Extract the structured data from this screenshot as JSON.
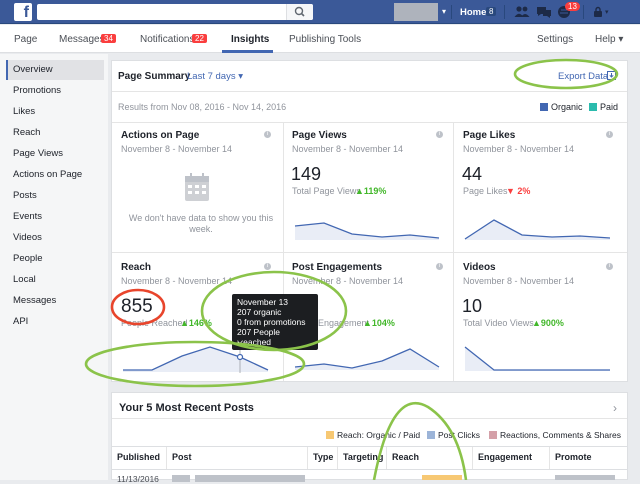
{
  "topbar": {
    "logo": "f",
    "home": "Home",
    "home_count": "8",
    "notif_count": "13"
  },
  "nav": {
    "page": "Page",
    "messages": "Messages",
    "messages_count": "34",
    "notifications": "Notifications",
    "notifications_count": "22",
    "insights": "Insights",
    "publishing_tools": "Publishing Tools",
    "settings": "Settings",
    "help": "Help ▾"
  },
  "sidebar": {
    "items": [
      "Overview",
      "Promotions",
      "Likes",
      "Reach",
      "Page Views",
      "Actions on Page",
      "Posts",
      "Events",
      "Videos",
      "People",
      "Local",
      "Messages",
      "API"
    ]
  },
  "summary": {
    "title": "Page Summary",
    "range": "Last 7 days ▾",
    "export": "Export Data",
    "results": "Results from Nov 08, 2016 - Nov 14, 2016",
    "legend_organic": "Organic",
    "legend_paid": "Paid"
  },
  "cards": {
    "actions": {
      "title": "Actions on Page",
      "date": "November 8 - November 14",
      "empty": "We don't have data to show you this week."
    },
    "views": {
      "title": "Page Views",
      "date": "November 8 - November 14",
      "value": "149",
      "label": "Total Page Views",
      "change": "▲119%"
    },
    "likes": {
      "title": "Page Likes",
      "date": "November 8 - November 14",
      "value": "44",
      "label": "Page Likes",
      "change": "▼ 2%"
    },
    "reach": {
      "title": "Reach",
      "date": "November 8 - November 14",
      "value": "855",
      "label": "People Reached",
      "change": "▲146%"
    },
    "engage": {
      "title": "Post Engagements",
      "date": "November 8 - November 14",
      "value": "6",
      "label": "Engagement",
      "change": "▲104%"
    },
    "videos": {
      "title": "Videos",
      "date": "November 8 - November 14",
      "value": "10",
      "label": "Total Video Views",
      "change": "▲900%"
    }
  },
  "tooltip": {
    "l1": "November 13",
    "l2": "207 organic",
    "l3": "0 from promotions",
    "l4": "207 People Reached"
  },
  "posts": {
    "title": "Your 5 Most Recent Posts",
    "legend": [
      "Reach: Organic / Paid",
      "Post Clicks",
      "Reactions, Comments & Shares"
    ],
    "headers": [
      "Published",
      "Post",
      "Type",
      "Targeting",
      "Reach",
      "Engagement",
      "Promote"
    ],
    "row_date": "11/13/2016"
  },
  "colors": {
    "organic": "#4267b2",
    "paid": "#2bbbad",
    "reach_legend": "#f7c873",
    "clicks_legend": "#9cb4d8",
    "reactions_legend": "#d4a0a8",
    "annotation_green": "#8bc34a",
    "annotation_red": "#e8452c"
  }
}
